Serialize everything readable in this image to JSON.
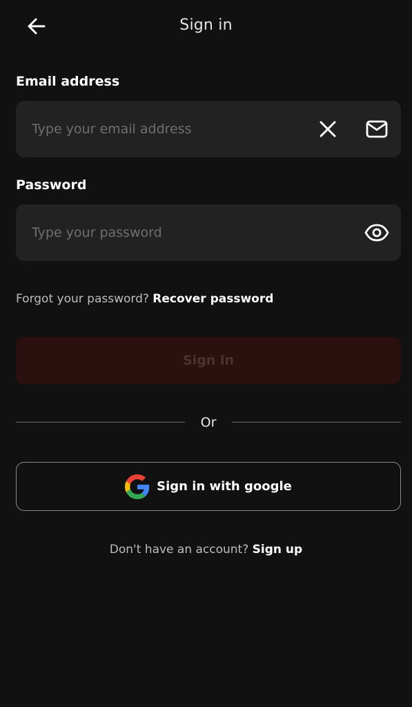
{
  "header": {
    "title": "Sign in",
    "back_icon": "arrow-left-icon"
  },
  "email": {
    "label": "Email address",
    "placeholder": "Type your email address",
    "value": "",
    "clear_icon": "close-icon",
    "field_icon": "mail-icon"
  },
  "password": {
    "label": "Password",
    "placeholder": "Type your password",
    "value": "",
    "toggle_icon": "eye-icon"
  },
  "forgot": {
    "prompt": "Forgot your password?",
    "link": "Recover password"
  },
  "signin_button": {
    "label": "Sign in",
    "state": "disabled"
  },
  "divider": {
    "label": "Or"
  },
  "google_button": {
    "label": "Sign in with google",
    "icon": "google-icon"
  },
  "signup": {
    "prompt": "Don't have an account?",
    "link": "Sign up"
  },
  "colors": {
    "background": "#111111",
    "field_background": "#222222",
    "signin_disabled_bg": "#2c1010",
    "signin_disabled_text": "#4e3131"
  }
}
